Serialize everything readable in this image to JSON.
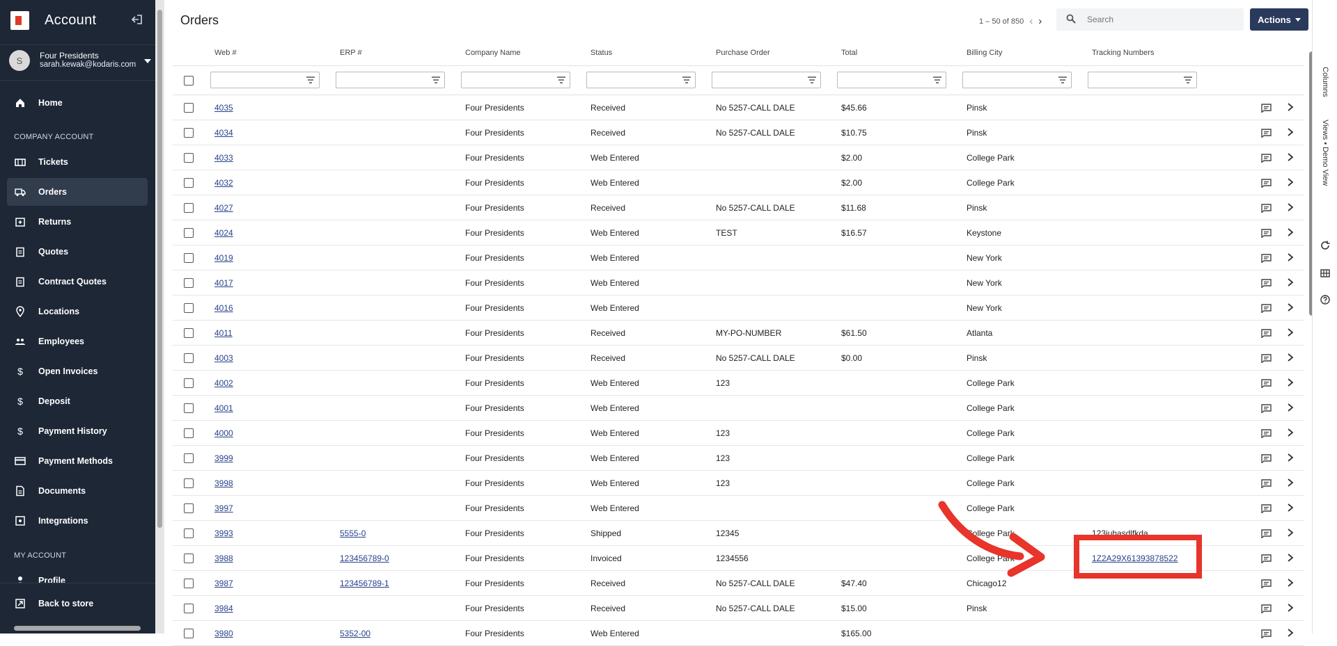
{
  "sidebar": {
    "brand_title": "Account",
    "account_name": "Four Presidents",
    "account_email": "sarah.kewak@kodaris.com",
    "avatar_initial": "S",
    "section_company": "COMPANY ACCOUNT",
    "section_my": "MY ACCOUNT",
    "items": [
      {
        "label": "Home",
        "icon": "home-icon"
      },
      {
        "label": "Tickets",
        "icon": "ticket-icon"
      },
      {
        "label": "Orders",
        "icon": "truck-icon"
      },
      {
        "label": "Returns",
        "icon": "return-icon"
      },
      {
        "label": "Quotes",
        "icon": "clipboard-icon"
      },
      {
        "label": "Contract Quotes",
        "icon": "clipboard-icon"
      },
      {
        "label": "Locations",
        "icon": "location-pin-icon"
      },
      {
        "label": "Employees",
        "icon": "people-icon"
      },
      {
        "label": "Open Invoices",
        "icon": "dollar-icon"
      },
      {
        "label": "Deposit",
        "icon": "dollar-icon"
      },
      {
        "label": "Payment History",
        "icon": "dollar-icon"
      },
      {
        "label": "Payment Methods",
        "icon": "credit-card-icon"
      },
      {
        "label": "Documents",
        "icon": "document-icon"
      },
      {
        "label": "Integrations",
        "icon": "integration-icon"
      },
      {
        "label": "Profile",
        "icon": "person-icon"
      },
      {
        "label": "Back to store",
        "icon": "external-icon"
      }
    ]
  },
  "header": {
    "title": "Orders",
    "pagination": "1 – 50 of 850",
    "search_placeholder": "Search",
    "actions_label": "Actions"
  },
  "columns": [
    "Web #",
    "ERP #",
    "Company Name",
    "Status",
    "Purchase Order",
    "Total",
    "Billing City",
    "Tracking Numbers"
  ],
  "rows": [
    {
      "web": "4035",
      "erp": "",
      "company": "Four Presidents",
      "status": "Received",
      "po": "No 5257-CALL DALE",
      "total": "$45.66",
      "city": "Pinsk",
      "tracking": ""
    },
    {
      "web": "4034",
      "erp": "",
      "company": "Four Presidents",
      "status": "Received",
      "po": "No 5257-CALL DALE",
      "total": "$10.75",
      "city": "Pinsk",
      "tracking": ""
    },
    {
      "web": "4033",
      "erp": "",
      "company": "Four Presidents",
      "status": "Web Entered",
      "po": "",
      "total": "$2.00",
      "city": "College Park",
      "tracking": ""
    },
    {
      "web": "4032",
      "erp": "",
      "company": "Four Presidents",
      "status": "Web Entered",
      "po": "",
      "total": "$2.00",
      "city": "College Park",
      "tracking": ""
    },
    {
      "web": "4027",
      "erp": "",
      "company": "Four Presidents",
      "status": "Received",
      "po": "No 5257-CALL DALE",
      "total": "$11.68",
      "city": "Pinsk",
      "tracking": ""
    },
    {
      "web": "4024",
      "erp": "",
      "company": "Four Presidents",
      "status": "Web Entered",
      "po": "TEST",
      "total": "$16.57",
      "city": "Keystone",
      "tracking": ""
    },
    {
      "web": "4019",
      "erp": "",
      "company": "Four Presidents",
      "status": "Web Entered",
      "po": "",
      "total": "",
      "city": "New York",
      "tracking": ""
    },
    {
      "web": "4017",
      "erp": "",
      "company": "Four Presidents",
      "status": "Web Entered",
      "po": "",
      "total": "",
      "city": "New York",
      "tracking": ""
    },
    {
      "web": "4016",
      "erp": "",
      "company": "Four Presidents",
      "status": "Web Entered",
      "po": "",
      "total": "",
      "city": "New York",
      "tracking": ""
    },
    {
      "web": "4011",
      "erp": "",
      "company": "Four Presidents",
      "status": "Received",
      "po": "MY-PO-NUMBER",
      "total": "$61.50",
      "city": "Atlanta",
      "tracking": ""
    },
    {
      "web": "4003",
      "erp": "",
      "company": "Four Presidents",
      "status": "Received",
      "po": "No 5257-CALL DALE",
      "total": "$0.00",
      "city": "Pinsk",
      "tracking": ""
    },
    {
      "web": "4002",
      "erp": "",
      "company": "Four Presidents",
      "status": "Web Entered",
      "po": "123",
      "total": "",
      "city": "College Park",
      "tracking": ""
    },
    {
      "web": "4001",
      "erp": "",
      "company": "Four Presidents",
      "status": "Web Entered",
      "po": "",
      "total": "",
      "city": "College Park",
      "tracking": ""
    },
    {
      "web": "4000",
      "erp": "",
      "company": "Four Presidents",
      "status": "Web Entered",
      "po": "123",
      "total": "",
      "city": "College Park",
      "tracking": ""
    },
    {
      "web": "3999",
      "erp": "",
      "company": "Four Presidents",
      "status": "Web Entered",
      "po": "123",
      "total": "",
      "city": "College Park",
      "tracking": ""
    },
    {
      "web": "3998",
      "erp": "",
      "company": "Four Presidents",
      "status": "Web Entered",
      "po": "123",
      "total": "",
      "city": "College Park",
      "tracking": ""
    },
    {
      "web": "3997",
      "erp": "",
      "company": "Four Presidents",
      "status": "Web Entered",
      "po": "",
      "total": "",
      "city": "College Park",
      "tracking": ""
    },
    {
      "web": "3993",
      "erp": "5555-0",
      "company": "Four Presidents",
      "status": "Shipped",
      "po": "12345",
      "total": "",
      "city": "College Park",
      "tracking": "123iuhasdlfkda"
    },
    {
      "web": "3988",
      "erp": "123456789-0",
      "company": "Four Presidents",
      "status": "Invoiced",
      "po": "1234556",
      "total": "",
      "city": "College Park",
      "tracking": "1Z2A29X61393878522"
    },
    {
      "web": "3987",
      "erp": "123456789-1",
      "company": "Four Presidents",
      "status": "Received",
      "po": "No 5257-CALL DALE",
      "total": "$47.40",
      "city": "Chicago12",
      "tracking": ""
    },
    {
      "web": "3984",
      "erp": "",
      "company": "Four Presidents",
      "status": "Received",
      "po": "No 5257-CALL DALE",
      "total": "$15.00",
      "city": "Pinsk",
      "tracking": ""
    },
    {
      "web": "3980",
      "erp": "5352-00",
      "company": "Four Presidents",
      "status": "Web Entered",
      "po": "",
      "total": "$165.00",
      "city": "",
      "tracking": ""
    }
  ],
  "right_rail": {
    "columns_label": "Columns",
    "views_label": "Views • Demo View"
  },
  "colors": {
    "sidebar_bg": "#1d2736",
    "accent": "#2a3a5c",
    "link": "#27428a",
    "annotation": "#e8342a"
  }
}
